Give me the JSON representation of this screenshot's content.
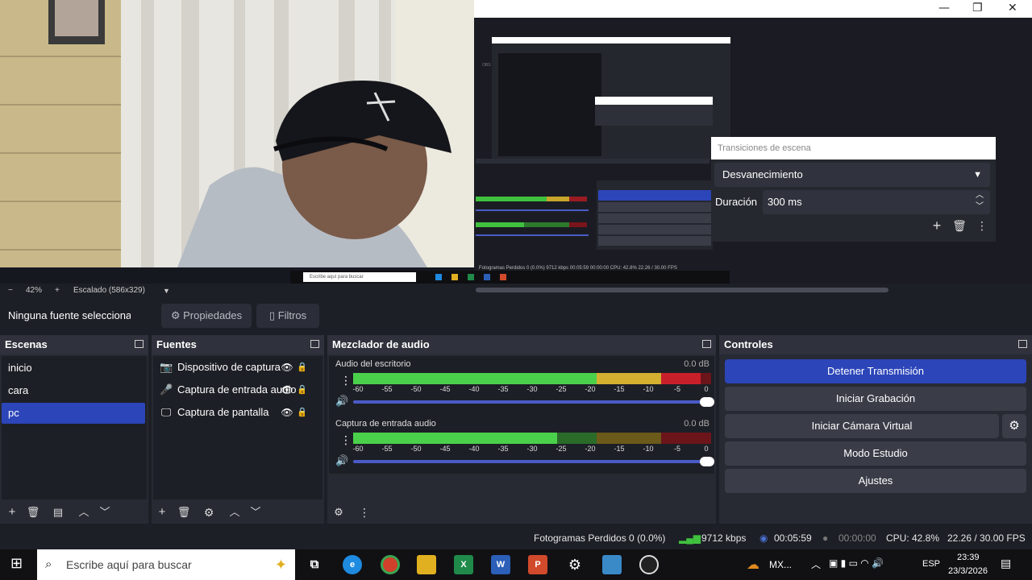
{
  "preview": {
    "window_controls": [
      "—",
      "❐",
      "✕"
    ],
    "transition_popup": {
      "title": "Transiciones de escena",
      "transition": "Desvanecimiento",
      "duration_label": "Duración",
      "duration_value": "300 ms"
    },
    "mini_search": "Escribe aquí para buscar"
  },
  "zoom": {
    "minus": "−",
    "value": "42%",
    "plus": "+",
    "scale_label": "Escalado (586x329)"
  },
  "sourcebar": {
    "no_source": "Ninguna fuente seleccionad",
    "properties": "Propiedades",
    "filters": "Filtros"
  },
  "scenes": {
    "title": "Escenas",
    "items": [
      "inicio",
      "cara",
      "pc"
    ],
    "selected": "pc"
  },
  "sources": {
    "title": "Fuentes",
    "items": [
      "Dispositivo de captura",
      "Captura de entrada audio",
      "Captura de pantalla"
    ]
  },
  "mixer": {
    "title": "Mezclador de audio",
    "channels": [
      {
        "name": "Audio del escritorio",
        "db": "0.0 dB",
        "level": 0.97
      },
      {
        "name": "Captura de entrada audio",
        "db": "0.0 dB",
        "level": 0.57
      }
    ],
    "ticks": [
      "-60",
      "-55",
      "-50",
      "-45",
      "-40",
      "-35",
      "-30",
      "-25",
      "-20",
      "-15",
      "-10",
      "-5",
      "0"
    ]
  },
  "controls": {
    "title": "Controles",
    "buttons": [
      "Detener Transmisión",
      "Iniciar Grabación",
      "Iniciar Cámara Virtual",
      "Modo Estudio",
      "Ajustes"
    ]
  },
  "status": {
    "dropped": "Fotogramas Perdidos 0 (0.0%)",
    "bitrate": "9712 kbps",
    "stream_time": "00:05:59",
    "rec_time": "00:00:00",
    "cpu": "CPU: 42.8%",
    "fps": "22.26 / 30.00 FPS"
  },
  "taskbar": {
    "search_placeholder": "Escribe aquí para buscar",
    "weather": "MX...",
    "lang": "ESP",
    "time": "23:39",
    "date": "23/3/2026"
  },
  "colors": {
    "accent": "#2c45b9",
    "meter_green": "#4bd04b",
    "meter_yellow": "#d4b030",
    "meter_red": "#c8202a"
  }
}
